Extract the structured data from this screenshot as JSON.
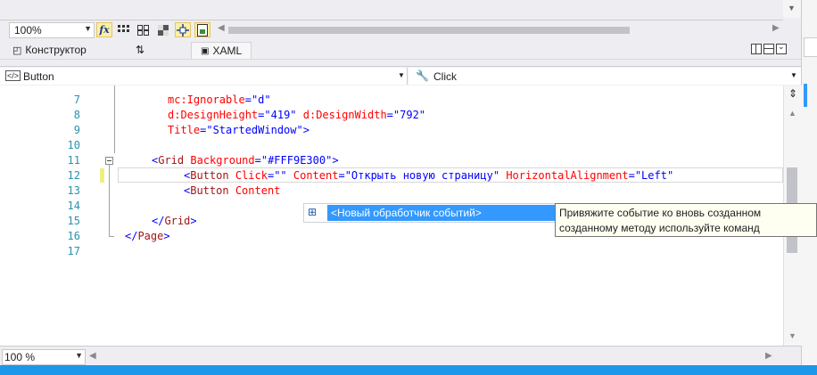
{
  "designer": {
    "zoom_value": "100%",
    "fx_label": "fx"
  },
  "tabs": {
    "designer_label": "Конструктор",
    "swap_label": "⇅",
    "xaml_label": "XAML"
  },
  "element_bar": {
    "element_value": "Button",
    "event_value": "Click"
  },
  "editor": {
    "line_numbers": [
      "7",
      "8",
      "9",
      "10",
      "11",
      "12",
      "13",
      "14",
      "15",
      "16",
      "17"
    ],
    "lines": [
      {
        "indent": "    ",
        "parts": [
          [
            "attr",
            "mc:Ignorable"
          ],
          [
            "punct",
            "="
          ],
          [
            "val",
            "\"d\""
          ]
        ]
      },
      {
        "indent": "    ",
        "parts": [
          [
            "attr",
            "d:DesignHeight"
          ],
          [
            "punct",
            "="
          ],
          [
            "val",
            "\"419\""
          ],
          [
            "plain",
            " "
          ],
          [
            "attr",
            "d:DesignWidth"
          ],
          [
            "punct",
            "="
          ],
          [
            "val",
            "\"792\""
          ]
        ]
      },
      {
        "indent": "    ",
        "parts": [
          [
            "attr",
            "Title"
          ],
          [
            "punct",
            "="
          ],
          [
            "val",
            "\"StartedWindow\""
          ],
          [
            "punct",
            ">"
          ]
        ]
      },
      {
        "indent": "",
        "parts": []
      },
      {
        "indent": "  ",
        "parts": [
          [
            "punct",
            "<"
          ],
          [
            "tag",
            "Grid"
          ],
          [
            "plain",
            " "
          ],
          [
            "attr",
            "Background"
          ],
          [
            "punct",
            "="
          ],
          [
            "val",
            "\"#FFF9E300\""
          ],
          [
            "punct",
            ">"
          ]
        ]
      },
      {
        "indent": "      ",
        "parts": [
          [
            "punct",
            "<"
          ],
          [
            "tag",
            "Button"
          ],
          [
            "plain",
            " "
          ],
          [
            "attr",
            "Click"
          ],
          [
            "punct",
            "="
          ],
          [
            "val",
            "\"\""
          ],
          [
            "plain",
            " "
          ],
          [
            "attr",
            "Content"
          ],
          [
            "punct",
            "="
          ],
          [
            "val",
            "\"Открыть новую страницу\""
          ],
          [
            "plain",
            " "
          ],
          [
            "attr",
            "HorizontalAlignment"
          ],
          [
            "punct",
            "="
          ],
          [
            "val",
            "\"Left\""
          ]
        ]
      },
      {
        "indent": "      ",
        "parts": [
          [
            "punct",
            "<"
          ],
          [
            "tag",
            "Button"
          ],
          [
            "plain",
            " "
          ],
          [
            "attr",
            "Content"
          ]
        ]
      },
      {
        "indent": "",
        "parts": []
      },
      {
        "indent": "  ",
        "parts": [
          [
            "punct",
            "</"
          ],
          [
            "tag",
            "Grid"
          ],
          [
            "punct",
            ">"
          ]
        ]
      },
      {
        "indent": "",
        "parts": [
          [
            "punct",
            "</"
          ],
          [
            "tag",
            "Page"
          ],
          [
            "punct",
            ">"
          ]
        ]
      },
      {
        "indent": "",
        "parts": []
      }
    ]
  },
  "completion": {
    "item_label": "<Новый обработчик событий>"
  },
  "tooltip": {
    "line1": "Привяжите событие ко вновь созданном",
    "line2": "созданному методу используйте команд"
  },
  "footer": {
    "zoom_value": "100 %"
  },
  "colors": {
    "accent": "#1c97ea",
    "selection": "#3399ff",
    "tag": "#a31515",
    "attribute": "#ff0000",
    "value": "#0000ff",
    "line_number": "#2b91af"
  }
}
